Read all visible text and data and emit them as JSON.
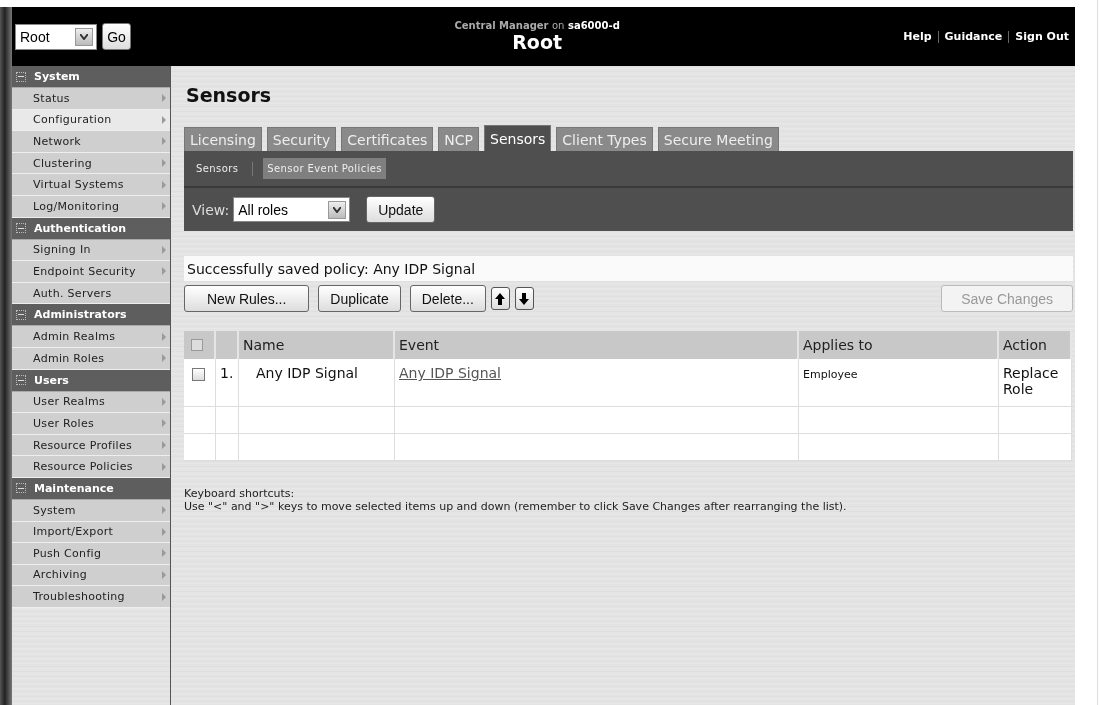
{
  "header": {
    "realm_select": {
      "value": "Root"
    },
    "go_button": "Go",
    "context": {
      "product": "Central Manager",
      "connector": "on",
      "host": "sa6000-d"
    },
    "title": "Root",
    "links": [
      "Help",
      "Guidance",
      "Sign Out"
    ]
  },
  "sidebar": {
    "sections": [
      {
        "title": "System",
        "expanded": true,
        "items": [
          {
            "label": "Status",
            "arrow": true,
            "selected": false
          },
          {
            "label": "Configuration",
            "arrow": true,
            "selected": true
          },
          {
            "label": "Network",
            "arrow": true,
            "selected": false
          },
          {
            "label": "Clustering",
            "arrow": true,
            "selected": false
          },
          {
            "label": "Virtual Systems",
            "arrow": true,
            "selected": false
          },
          {
            "label": "Log/Monitoring",
            "arrow": true,
            "selected": false
          }
        ]
      },
      {
        "title": "Authentication",
        "expanded": true,
        "items": [
          {
            "label": "Signing In",
            "arrow": true,
            "selected": false
          },
          {
            "label": "Endpoint Security",
            "arrow": true,
            "selected": false
          },
          {
            "label": "Auth. Servers",
            "arrow": false,
            "selected": false
          }
        ]
      },
      {
        "title": "Administrators",
        "expanded": true,
        "items": [
          {
            "label": "Admin Realms",
            "arrow": true,
            "selected": false
          },
          {
            "label": "Admin Roles",
            "arrow": true,
            "selected": false
          }
        ]
      },
      {
        "title": "Users",
        "expanded": true,
        "items": [
          {
            "label": "User Realms",
            "arrow": true,
            "selected": false
          },
          {
            "label": "User Roles",
            "arrow": true,
            "selected": false
          },
          {
            "label": "Resource Profiles",
            "arrow": true,
            "selected": false
          },
          {
            "label": "Resource Policies",
            "arrow": true,
            "selected": false
          }
        ]
      },
      {
        "title": "Maintenance",
        "expanded": true,
        "items": [
          {
            "label": "System",
            "arrow": true,
            "selected": false
          },
          {
            "label": "Import/Export",
            "arrow": true,
            "selected": false
          },
          {
            "label": "Push Config",
            "arrow": true,
            "selected": false
          },
          {
            "label": "Archiving",
            "arrow": true,
            "selected": false
          },
          {
            "label": "Troubleshooting",
            "arrow": true,
            "selected": false
          }
        ]
      }
    ]
  },
  "page_title": "Sensors",
  "tabs": [
    {
      "label": "Licensing",
      "selected": false
    },
    {
      "label": "Security",
      "selected": false
    },
    {
      "label": "Certificates",
      "selected": false
    },
    {
      "label": "NCP",
      "selected": false
    },
    {
      "label": "Sensors",
      "selected": true
    },
    {
      "label": "Client Types",
      "selected": false
    },
    {
      "label": "Secure Meeting",
      "selected": false
    }
  ],
  "subtabs": [
    {
      "label": "Sensors",
      "selected": false
    },
    {
      "label": "Sensor Event Policies",
      "selected": true
    }
  ],
  "view": {
    "label": "View:",
    "value": "All roles",
    "button": "Update"
  },
  "message": "Successfully saved policy: Any IDP Signal",
  "toolbar": [
    {
      "kind": "text",
      "label": "New Rules..."
    },
    {
      "kind": "text",
      "label": "Duplicate"
    },
    {
      "kind": "text",
      "label": "Delete..."
    },
    {
      "kind": "up"
    },
    {
      "kind": "down"
    }
  ],
  "save_button": {
    "label": "Save Changes",
    "disabled": true
  },
  "table": {
    "select_all_checked": false,
    "columns": [
      "Name",
      "Event",
      "Applies to",
      "Action"
    ],
    "rows": [
      {
        "checked": false,
        "number": "1.",
        "name": "Any IDP Signal",
        "event": "Any IDP Signal",
        "applies_to": "Employee",
        "action": "Replace Role"
      }
    ]
  },
  "shortcuts": {
    "title": "Keyboard shortcuts:",
    "text": "Use \"<\" and \">\" keys to move selected items up and down (remember to click Save Changes after rearranging the list)."
  }
}
